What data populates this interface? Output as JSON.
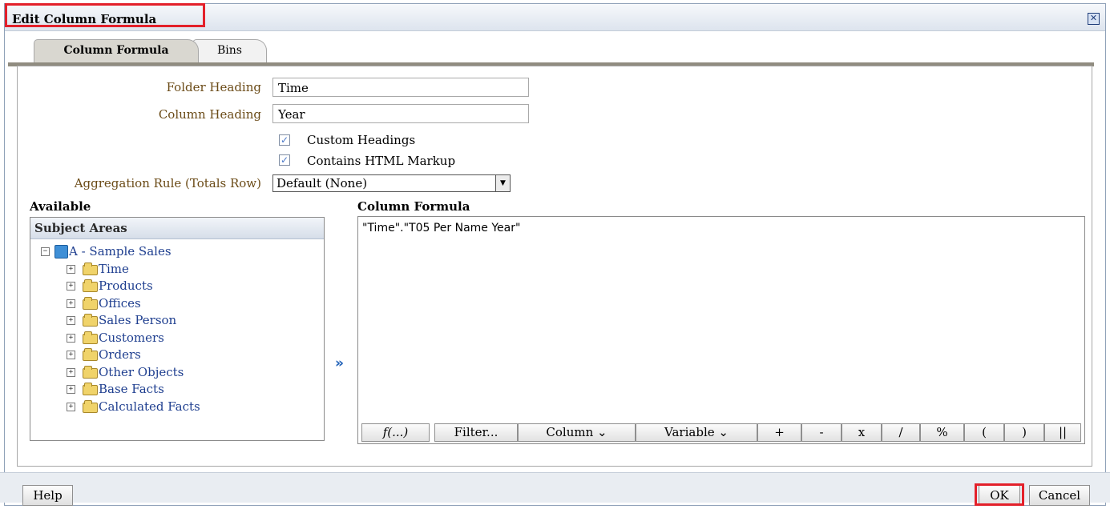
{
  "dialog": {
    "title": "Edit Column Formula",
    "close_icon": "close-icon"
  },
  "tabs": [
    {
      "label": "Column Formula",
      "active": true
    },
    {
      "label": "Bins",
      "active": false
    }
  ],
  "form": {
    "folder_heading_label": "Folder Heading",
    "folder_heading_value": "Time",
    "column_heading_label": "Column Heading",
    "column_heading_value": "Year",
    "custom_headings_label": "Custom Headings",
    "custom_headings_checked": true,
    "html_markup_label": "Contains HTML Markup",
    "html_markup_checked": true,
    "aggregation_label": "Aggregation Rule (Totals Row)",
    "aggregation_value": "Default (None)"
  },
  "available": {
    "label": "Available",
    "panel_header": "Subject Areas",
    "root": "A - Sample Sales",
    "folders": [
      "Time",
      "Products",
      "Offices",
      "Sales Person",
      "Customers",
      "Orders",
      "Other Objects",
      "Base Facts",
      "Calculated Facts"
    ]
  },
  "formula": {
    "label": "Column Formula",
    "text": "\"Time\".\"T05 Per Name Year\"",
    "toolbar": [
      "f(...)",
      "Filter...",
      "Column ⌄",
      "Variable ⌄",
      "+",
      "-",
      "x",
      "/",
      "%",
      "(",
      ")",
      "||"
    ]
  },
  "footer": {
    "help": "Help",
    "ok": "OK",
    "cancel": "Cancel"
  },
  "colors": {
    "highlight": "#e3202a",
    "label_brown": "#6b4b17",
    "tree_blue": "#1e3e8f"
  }
}
